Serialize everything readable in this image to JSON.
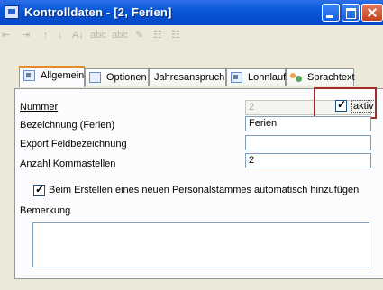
{
  "window": {
    "title": "Kontrolldaten - [2, Ferien]",
    "accent": "#0a58d8",
    "highlight_color": "#a42b2b"
  },
  "toolbar": {
    "items": [
      "⇤",
      "⇥",
      "↑",
      "↓",
      "A↓",
      "abc",
      "abc",
      "✎",
      "☷",
      "☷"
    ]
  },
  "tabs": [
    {
      "label": "Allgemein",
      "icon": "general-icon",
      "active": true
    },
    {
      "label": "Optionen",
      "icon": "options-icon",
      "active": false
    },
    {
      "label": "Jahresanspruch",
      "icon": "",
      "active": false
    },
    {
      "label": "Lohnlauf",
      "icon": "pay-run-icon",
      "active": false
    },
    {
      "label": "Sprachtext",
      "icon": "language-icon",
      "active": false
    }
  ],
  "form": {
    "nummer_label": "Nummer",
    "nummer_value": "2",
    "aktiv_label": "aktiv",
    "aktiv_checked": true,
    "bezeichnung_label": "Bezeichnung (Ferien)",
    "bezeichnung_value": "Ferien",
    "export_label": "Export Feldbezeichnung",
    "export_value": "",
    "kommastellen_label": "Anzahl Kommastellen",
    "kommastellen_value": "2",
    "auto_add_label": "Beim Erstellen eines neuen Personalstammes automatisch hinzufügen",
    "auto_add_checked": true,
    "bemerkung_label": "Bemerkung",
    "bemerkung_value": ""
  }
}
